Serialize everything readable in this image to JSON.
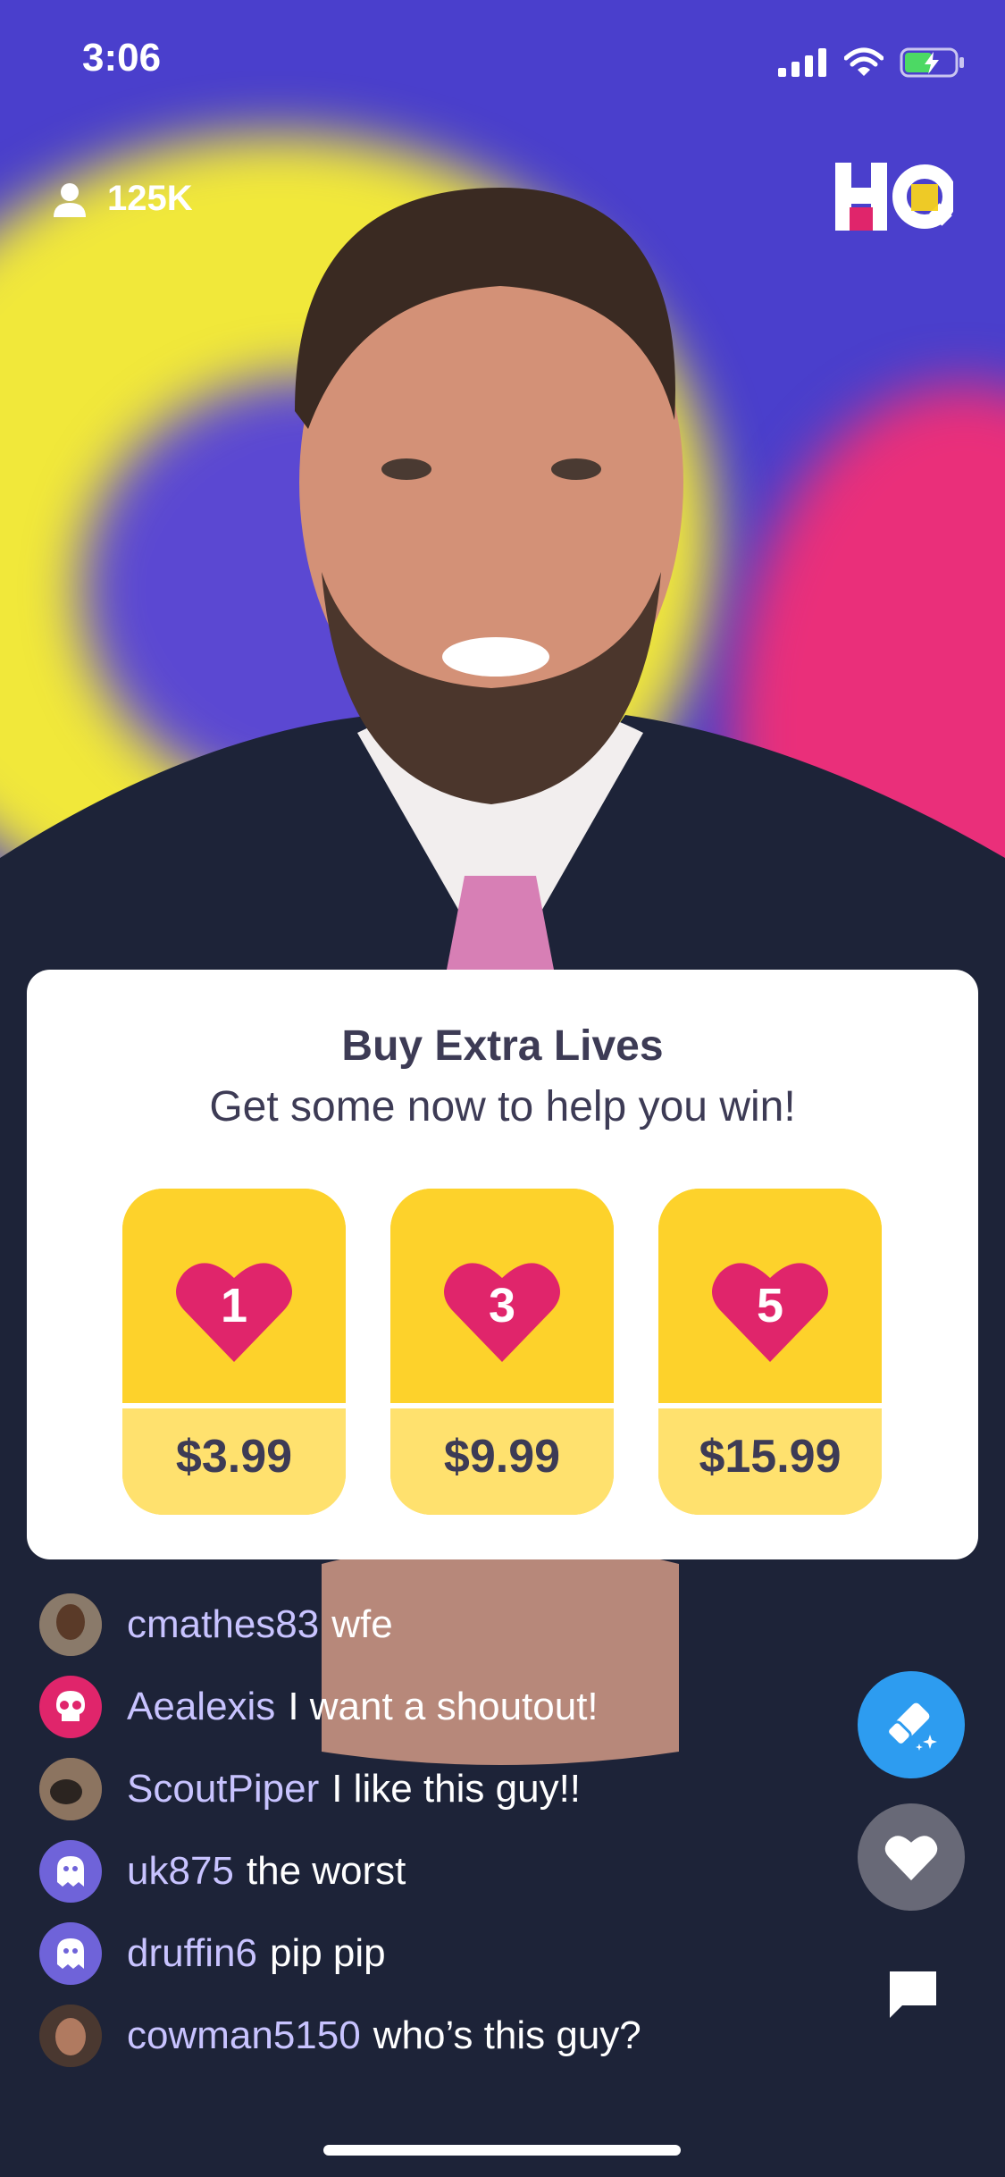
{
  "status_bar": {
    "time": "3:06"
  },
  "header": {
    "viewer_count": "125K",
    "logo_letters": "HQ"
  },
  "purchase_card": {
    "title": "Buy Extra Lives",
    "subtitle": "Get some now to help you win!",
    "options": [
      {
        "lives": "1",
        "price": "$3.99"
      },
      {
        "lives": "3",
        "price": "$9.99"
      },
      {
        "lives": "5",
        "price": "$15.99"
      }
    ]
  },
  "chat": {
    "messages": [
      {
        "user": "cmathes83",
        "text": "wfe"
      },
      {
        "user": "Aealexis",
        "text": "I want a shoutout!"
      },
      {
        "user": "ScoutPiper",
        "text": "I like this guy!!"
      },
      {
        "user": "uk875",
        "text": "the worst"
      },
      {
        "user": "druffin6",
        "text": "pip pip"
      },
      {
        "user": "cowman5150",
        "text": "who’s this guy?"
      }
    ]
  },
  "colors": {
    "card_yellow": "#fdd22b",
    "price_yellow": "#ffe16e",
    "heart_pink": "#e0256b",
    "eraser_blue": "#2d9cf0",
    "username_lavender": "#c8c3ff"
  },
  "icons": {
    "viewers": "person-icon",
    "eraser": "eraser-icon",
    "like": "heart-icon",
    "chat": "chat-bubble-icon"
  }
}
